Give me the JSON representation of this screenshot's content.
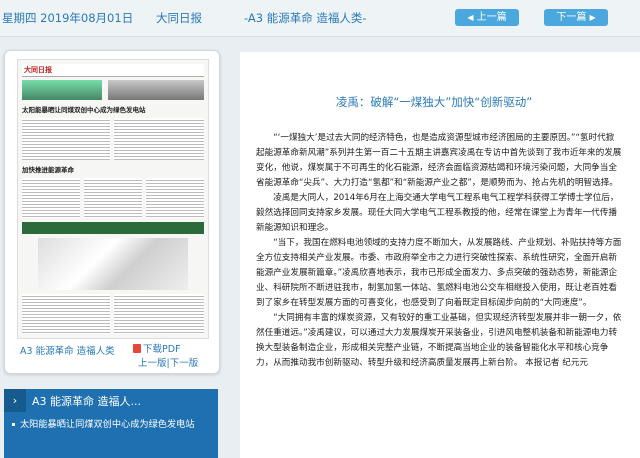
{
  "header": {
    "date": "星期四 2019年08月01日",
    "paper": "大同日报",
    "section": "-A3 能源革命 造福人类-",
    "prev_label": "上一篇",
    "next_label": "下一篇"
  },
  "thumbnail": {
    "masthead": "大同日报",
    "headline_1": "太阳能暴晒让同煤双创中心成为绿色发电站",
    "headline_2": "加快推进能源革命",
    "section_label": "A3 能源革命 造福人类",
    "pdf_label": "下载PDF",
    "prev_page": "上一版",
    "next_page": "下一版",
    "separator": "|"
  },
  "nav": {
    "section_title": "A3 能源革命 造福人...",
    "items": [
      "太阳能暴晒让同煤双创中心成为绿色发电站"
    ]
  },
  "article": {
    "title": "凌禹：破解“一煤独大”加快“创新驱动”",
    "paragraphs": [
      "“‘一煤独大’是过去大同的经济特色，也是造成资源型城市经济困局的主要原因。”“氢时代掀起能源革命新风潮”系列并生第一百二十五期主讲嘉宾凌禹在专访中首先谈到了我市近年来的发展变化，他说，煤炭属于不可再生的化石能源，经济会面临资源枯竭和环境污染问题，大同争当全省能源革命“尖兵”、大力打造“氢都”和“新能源产业之都”，是顺势而为、抢占先机的明智选择。",
      "凌禹是大同人，2014年6月在上海交通大学电气工程系电气工程学科获得工学博士学位后，毅然选择回同支持家乡发展。现任大同大学电气工程系教授的他，经常在课堂上为青年一代传播新能源知识和理念。",
      "“当下，我国在燃料电池领域的支持力度不断加大，从发展路线、产业规划、补贴扶持等方面全方位支持相关产业发展。市委、市政府举全市之力进行突破性探索、系统性研究，全面开启新能源产业发展新篇章。”凌禹欣喜地表示，我市已形成全面发力、多点突破的强劲态势，新能源企业、科研院所不断进驻我市，制氢加氢一体站、氢燃料电池公交车相继投入使用，既让老百姓看到了家乡在转型发展方面的可喜变化，也感受到了向着既定目标阔步向前的“大同速度”。",
      "“大同拥有丰富的煤炭资源，又有较好的重工业基础，但实现经济转型发展并非一朝一夕，依然任重道远。”凌禹建议，可以通过大力发展煤炭开采装备业，引进风电整机装备和新能源电力转换大型装备制造企业，形成相关完整产业链，不断提高当地企业的装备智能化水平和核心竞争力，从而推动我市创新驱动、转型升级和经济高质量发展再上新台阶。 本报记者 纪元元"
    ]
  },
  "colors": {
    "accent": "#2a7ab8",
    "button": "#4aa8de",
    "nav_bg": "#1e70b0"
  }
}
